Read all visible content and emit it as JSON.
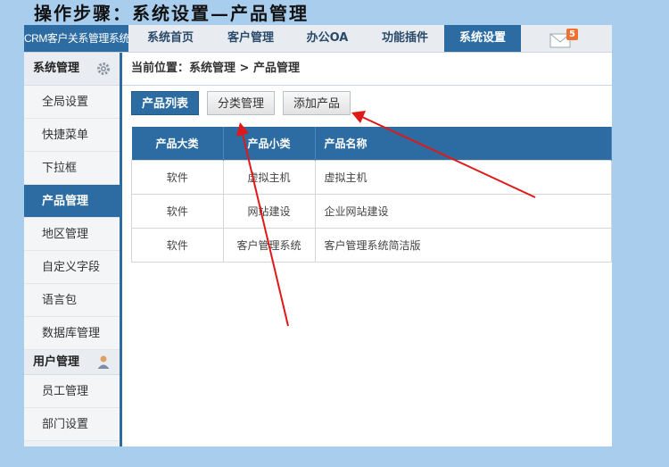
{
  "page_title": "操作步骤：系统设置—产品管理",
  "app": {
    "brand": "CRM客户关系管理系统",
    "nav": [
      "系统首页",
      "客户管理",
      "办公OA",
      "功能插件",
      "系统设置"
    ],
    "nav_active": "系统设置",
    "mail_count": "5"
  },
  "sidebar": {
    "group1": "系统管理",
    "items": [
      "全局设置",
      "快捷菜单",
      "下拉框",
      "产品管理",
      "地区管理",
      "自定义字段",
      "语言包",
      "数据库管理"
    ],
    "active": "产品管理",
    "group2": "用户管理",
    "items2": [
      "员工管理",
      "部门设置"
    ]
  },
  "breadcrumb": "当前位置：系统管理 > 产品管理",
  "toolbar": {
    "list_label": "产品列表",
    "category_label": "分类管理",
    "add_label": "添加产品"
  },
  "table": {
    "headers": [
      "产品大类",
      "产品小类",
      "产品名称"
    ],
    "rows": [
      [
        "软件",
        "虚拟主机",
        "虚拟主机"
      ],
      [
        "软件",
        "网站建设",
        "企业网站建设"
      ],
      [
        "软件",
        "客户管理系统",
        "客户管理系统简洁版"
      ]
    ]
  },
  "colors": {
    "accent": "#2d6ca2",
    "background": "#a9cdec",
    "annotation": "#e01818"
  }
}
